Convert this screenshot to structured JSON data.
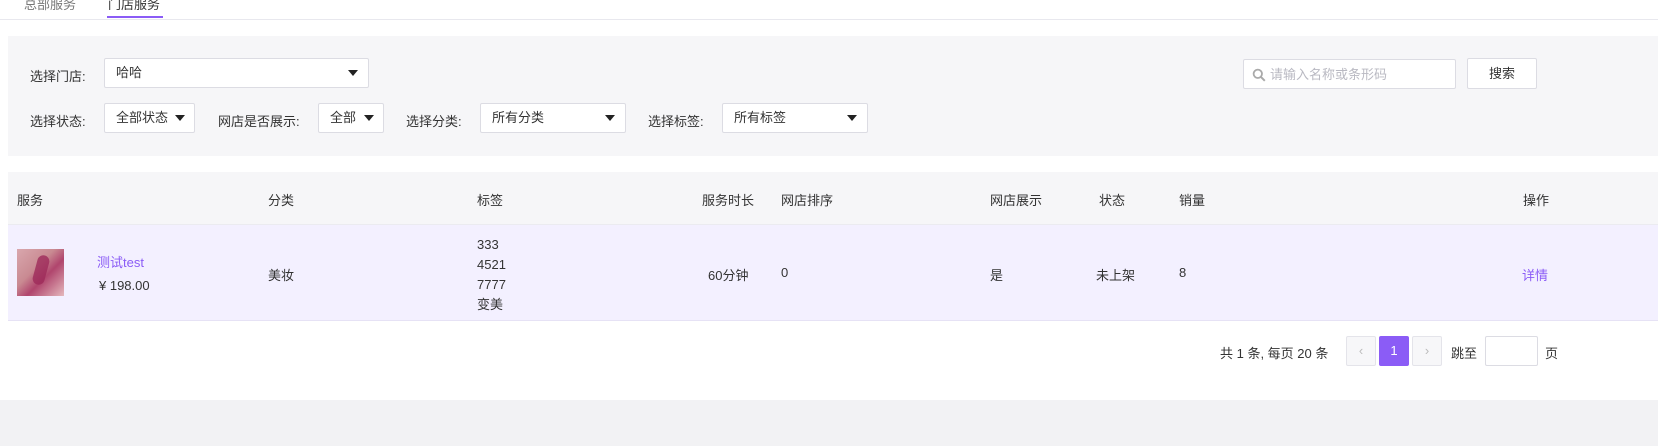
{
  "tabs": [
    "总部服务",
    "门店服务"
  ],
  "filters": {
    "store_label": "选择门店:",
    "store_value": "哈哈",
    "status_label": "选择状态:",
    "status_value": "全部状态",
    "online_label": "网店是否展示:",
    "online_value": "全部",
    "category_label": "选择分类:",
    "category_value": "所有分类",
    "tag_label": "选择标签:",
    "tag_value": "所有标签",
    "search_placeholder": "请输入名称或条形码",
    "search_button": "搜索"
  },
  "table": {
    "headers": [
      "服务",
      "分类",
      "标签",
      "服务时长",
      "网店排序",
      "网店展示",
      "状态",
      "销量",
      "操作"
    ],
    "rows": [
      {
        "name": "测试test",
        "price": "¥ 198.00",
        "category": "美妆",
        "tags": [
          "333",
          "4521",
          "7777",
          "变美"
        ],
        "duration": "60分钟",
        "sort": "0",
        "online": "是",
        "status": "未上架",
        "sales": "8",
        "action": "详情"
      }
    ]
  },
  "pagination": {
    "summary": "共 1 条, 每页 20 条",
    "prev": "‹",
    "current": "1",
    "next": "›",
    "jump_label": "跳至",
    "page_unit": "页"
  },
  "colors": {
    "accent": "#8b5cf6",
    "row_highlight": "#f3f0ff",
    "panel_bg": "#f6f6f8"
  }
}
